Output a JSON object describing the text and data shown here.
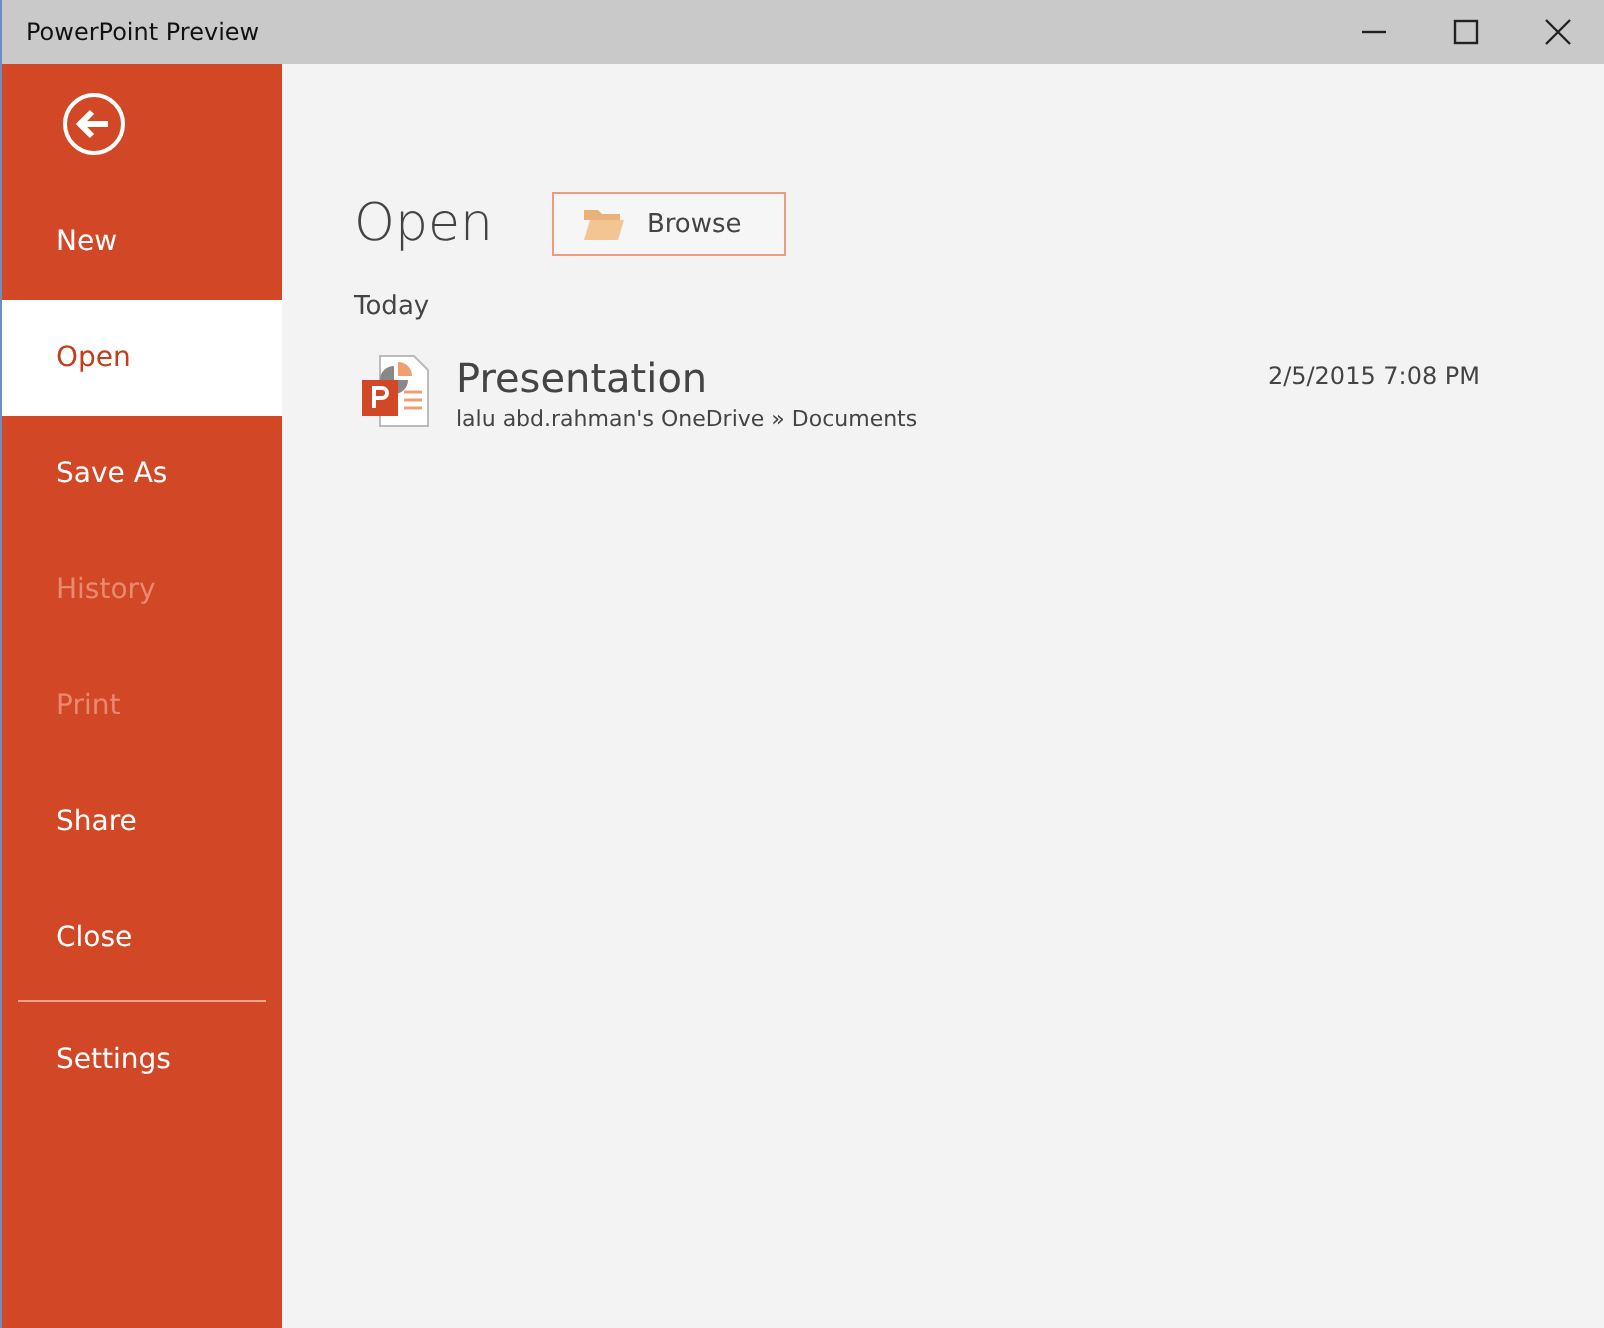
{
  "window": {
    "title": "PowerPoint Preview"
  },
  "sidebar": {
    "items": [
      {
        "label": "New",
        "selected": false,
        "disabled": false
      },
      {
        "label": "Open",
        "selected": true,
        "disabled": false
      },
      {
        "label": "Save As",
        "selected": false,
        "disabled": false
      },
      {
        "label": "History",
        "selected": false,
        "disabled": true
      },
      {
        "label": "Print",
        "selected": false,
        "disabled": true
      },
      {
        "label": "Share",
        "selected": false,
        "disabled": false
      },
      {
        "label": "Close",
        "selected": false,
        "disabled": false
      }
    ],
    "bottom_items": [
      {
        "label": "Settings",
        "selected": false,
        "disabled": false
      }
    ]
  },
  "main": {
    "heading": "Open",
    "browse_button": "Browse",
    "section": "Today",
    "files": [
      {
        "name": "Presentation",
        "location": "lalu abd.rahman's OneDrive » Documents",
        "modified": "2/5/2015 7:08 PM"
      }
    ]
  }
}
